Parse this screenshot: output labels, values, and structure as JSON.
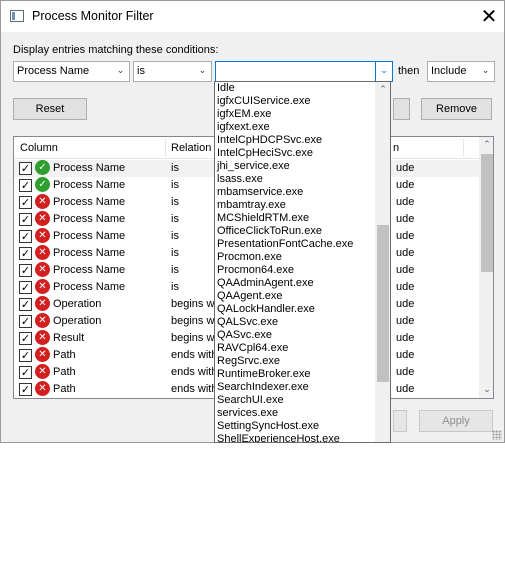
{
  "window": {
    "title": "Process Monitor Filter",
    "close_glyph": "✕",
    "app_icon": "filter-window-icon"
  },
  "conditions": {
    "label": "Display entries matching these conditions:",
    "column_value": "Process Name",
    "relation_value": "is",
    "value_text": "",
    "then_label": "then",
    "action_value": "Include"
  },
  "buttons": {
    "reset": "Reset",
    "remove": "Remove",
    "apply": "Apply"
  },
  "filter_list": {
    "headers": {
      "column": "Column",
      "relation": "Relation",
      "action_fragment": "n"
    },
    "rows": [
      {
        "checked": true,
        "status": "include",
        "column": "Process Name",
        "relation": "is",
        "action": "ude"
      },
      {
        "checked": true,
        "status": "include",
        "column": "Process Name",
        "relation": "is",
        "action": "ude"
      },
      {
        "checked": true,
        "status": "exclude",
        "column": "Process Name",
        "relation": "is",
        "action": "ude"
      },
      {
        "checked": true,
        "status": "exclude",
        "column": "Process Name",
        "relation": "is",
        "action": "ude"
      },
      {
        "checked": true,
        "status": "exclude",
        "column": "Process Name",
        "relation": "is",
        "action": "ude"
      },
      {
        "checked": true,
        "status": "exclude",
        "column": "Process Name",
        "relation": "is",
        "action": "ude"
      },
      {
        "checked": true,
        "status": "exclude",
        "column": "Process Name",
        "relation": "is",
        "action": "ude"
      },
      {
        "checked": true,
        "status": "exclude",
        "column": "Process Name",
        "relation": "is",
        "action": "ude"
      },
      {
        "checked": true,
        "status": "exclude",
        "column": "Operation",
        "relation": "begins with",
        "action": "ude"
      },
      {
        "checked": true,
        "status": "exclude",
        "column": "Operation",
        "relation": "begins with",
        "action": "ude"
      },
      {
        "checked": true,
        "status": "exclude",
        "column": "Result",
        "relation": "begins with",
        "action": "ude"
      },
      {
        "checked": true,
        "status": "exclude",
        "column": "Path",
        "relation": "ends with",
        "action": "ude"
      },
      {
        "checked": true,
        "status": "exclude",
        "column": "Path",
        "relation": "ends with",
        "action": "ude"
      },
      {
        "checked": true,
        "status": "exclude",
        "column": "Path",
        "relation": "ends with",
        "action": "ude"
      }
    ]
  },
  "dropdown": {
    "items": [
      "Idle",
      "igfxCUIService.exe",
      "igfxEM.exe",
      "igfxext.exe",
      "IntelCpHDCPSvc.exe",
      "IntelCpHeciSvc.exe",
      "jhi_service.exe",
      "lsass.exe",
      "mbamservice.exe",
      "mbamtray.exe",
      "MCShieldRTM.exe",
      "OfficeClickToRun.exe",
      "PresentationFontCache.exe",
      "Procmon.exe",
      "Procmon64.exe",
      "QAAdminAgent.exe",
      "QAAgent.exe",
      "QALockHandler.exe",
      "QALSvc.exe",
      "QASvc.exe",
      "RAVCpl64.exe",
      "RegSrvc.exe",
      "RuntimeBroker.exe",
      "SearchIndexer.exe",
      "SearchUI.exe",
      "services.exe",
      "SettingSyncHost.exe",
      "ShellExperienceHost.exe"
    ]
  },
  "glyphs": {
    "arrow_down": "⌄",
    "arrow_up": "⌃",
    "check": "✓",
    "include_mark": "✓",
    "exclude_mark": "✕"
  }
}
